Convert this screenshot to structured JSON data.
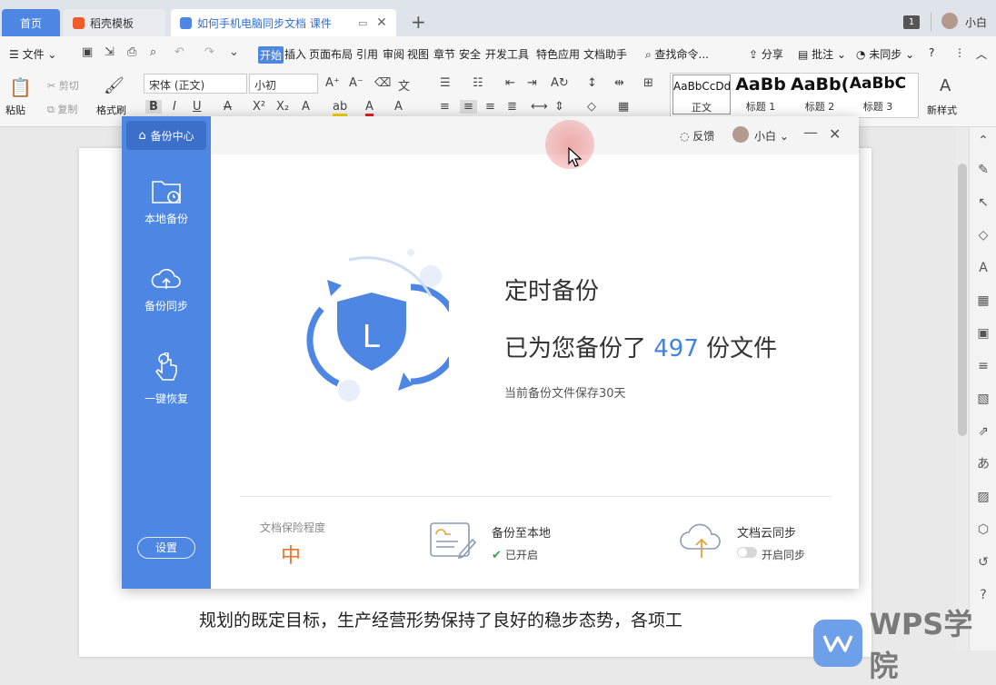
{
  "tabs": {
    "home": "首页",
    "template": "稻壳模板",
    "doc": "如何手机电脑同步文档 课件"
  },
  "window": {
    "badge": "1",
    "user": "小白"
  },
  "menu": {
    "file": "文件",
    "items": [
      "开始",
      "插入",
      "页面布局",
      "引用",
      "审阅",
      "视图",
      "章节",
      "安全",
      "开发工具",
      "特色应用",
      "文档助手"
    ],
    "search": "查找命令...",
    "share": "分享",
    "comment": "批注",
    "sync": "未同步",
    "help": "?"
  },
  "ribbon": {
    "paste": "粘贴",
    "cut": "剪切",
    "copy": "复制",
    "format_painter": "格式刷",
    "font": "宋体 (正文)",
    "size": "小初",
    "new_style": "新样式"
  },
  "styles": [
    {
      "preview": "AaBbCcDd",
      "name": "正文"
    },
    {
      "preview": "AaBb",
      "name": "标题 1"
    },
    {
      "preview": "AaBb(",
      "name": "标题 2"
    },
    {
      "preview": "AaBbC",
      "name": "标题 3"
    }
  ],
  "dialog": {
    "sidebar": {
      "header": "备份中心",
      "items": [
        "本地备份",
        "备份同步",
        "一键恢复"
      ],
      "settings": "设置"
    },
    "header": {
      "feedback": "反馈",
      "user": "小白"
    },
    "main": {
      "title": "定时备份",
      "line_prefix": "已为您备份了 ",
      "count": "497",
      "line_suffix": " 份文件",
      "note": "当前备份文件保存30天",
      "shield_letter": "L"
    },
    "footer": {
      "insurance_label": "文档保险程度",
      "insurance_level": "中",
      "local_title": "备份至本地",
      "local_status": "已开启",
      "cloud_title": "文档云同步",
      "cloud_status": "开启同步"
    }
  },
  "document": {
    "body_text": "规划的既定目标，生产经营形势保持了良好的稳步态势，各项工"
  },
  "watermark": {
    "text": "WPS学院"
  },
  "colors": {
    "accent": "#4e86e4",
    "number": "#3f84e5",
    "level": "#e8742b",
    "ok": "#3aa34a"
  }
}
